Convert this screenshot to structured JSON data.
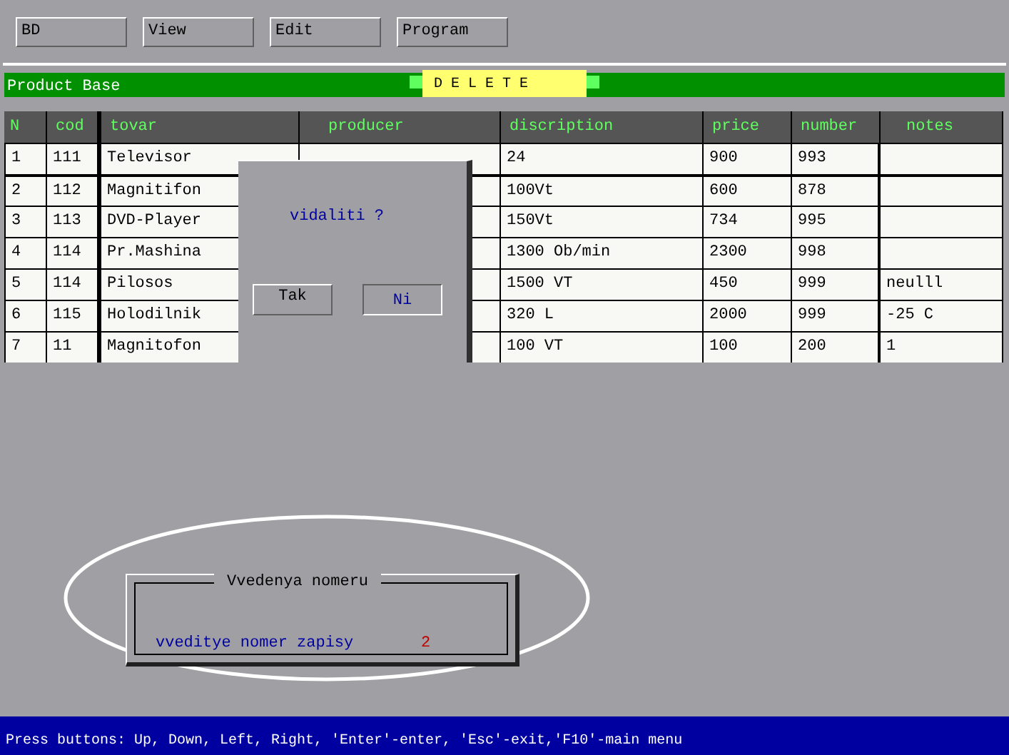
{
  "menu": [
    {
      "label": "BD"
    },
    {
      "label": "View"
    },
    {
      "label": "Edit"
    },
    {
      "label": "Program"
    }
  ],
  "title_bar": {
    "title": "Product Base",
    "mode": "D E L E T E"
  },
  "table": {
    "columns": [
      "N",
      "cod",
      "tovar",
      "producer",
      "discription",
      "price",
      "number",
      "notes"
    ],
    "rows": [
      [
        "1",
        "111",
        "Televisor",
        "",
        "24",
        "900",
        "993",
        ""
      ],
      [
        "2",
        "112",
        "Magnitifon",
        "",
        "100Vt",
        "600",
        "878",
        ""
      ],
      [
        "3",
        "113",
        "DVD-Player",
        "",
        "150Vt",
        "734",
        "995",
        ""
      ],
      [
        "4",
        "114",
        "Pr.Mashina",
        "",
        "1300 Ob/min",
        "2300",
        "998",
        ""
      ],
      [
        "5",
        "114",
        "Pilosos",
        "",
        "1500 VT",
        "450",
        "999",
        "neulll"
      ],
      [
        "6",
        "115",
        "Holodilnik",
        "",
        "320 L",
        "2000",
        "999",
        "-25 C"
      ],
      [
        "7",
        "11",
        "Magnitofon",
        "",
        "100 VT",
        "100",
        "200",
        "1"
      ]
    ]
  },
  "confirm_dialog": {
    "question": "vidaliti ?",
    "buttons": [
      {
        "label": "Tak",
        "selected": false
      },
      {
        "label": "Ni",
        "selected": true
      }
    ]
  },
  "input_box": {
    "title": "Vvedenya nomeru",
    "prompt": "vveditye nomer zapisy",
    "value": "2"
  },
  "status_bar": "Press buttons: Up, Down, Left, Right, 'Enter'-enter, 'Esc'-exit,'F10'-main menu"
}
